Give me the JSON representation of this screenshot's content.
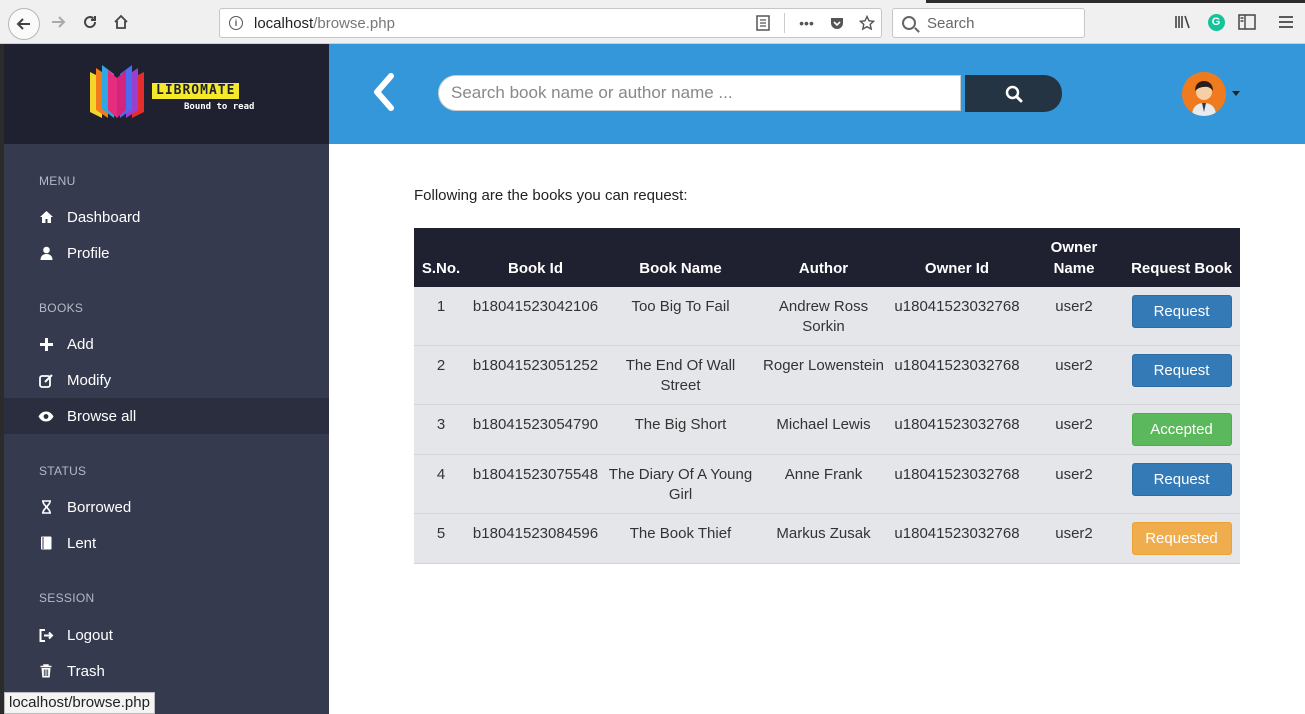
{
  "browser": {
    "url_host": "localhost",
    "url_path": "/browse.php",
    "search_placeholder": "Search",
    "status_url": "localhost/browse.php"
  },
  "logo": {
    "name": "LIBROMATE",
    "tagline": "Bound to read"
  },
  "sidebar": {
    "sections": [
      {
        "title": "MENU",
        "items": [
          {
            "label": "Dashboard",
            "icon": "home-icon"
          },
          {
            "label": "Profile",
            "icon": "user-icon"
          }
        ]
      },
      {
        "title": "BOOKS",
        "items": [
          {
            "label": "Add",
            "icon": "plus-icon"
          },
          {
            "label": "Modify",
            "icon": "edit-icon"
          },
          {
            "label": "Browse all",
            "icon": "eye-icon",
            "active": true
          }
        ]
      },
      {
        "title": "STATUS",
        "items": [
          {
            "label": "Borrowed",
            "icon": "hourglass-icon"
          },
          {
            "label": "Lent",
            "icon": "book-icon"
          }
        ]
      },
      {
        "title": "SESSION",
        "items": [
          {
            "label": "Logout",
            "icon": "logout-icon"
          },
          {
            "label": "Trash",
            "icon": "trash-icon"
          }
        ]
      }
    ]
  },
  "header": {
    "search_placeholder": "Search book name or author name ..."
  },
  "main": {
    "intro": "Following are the books you can request:",
    "columns": [
      "S.No.",
      "Book Id",
      "Book Name",
      "Author",
      "Owner Id",
      "Owner Name",
      "Request Book"
    ],
    "rows": [
      {
        "sno": "1",
        "book_id": "b18041523042106",
        "book_name": "Too Big To Fail",
        "author": "Andrew Ross Sorkin",
        "owner_id": "u18041523032768",
        "owner_name": "user2",
        "action": "Request",
        "status": "primary"
      },
      {
        "sno": "2",
        "book_id": "b18041523051252",
        "book_name": "The End Of Wall Street",
        "author": "Roger Lowenstein",
        "owner_id": "u18041523032768",
        "owner_name": "user2",
        "action": "Request",
        "status": "primary"
      },
      {
        "sno": "3",
        "book_id": "b18041523054790",
        "book_name": "The Big Short",
        "author": "Michael Lewis",
        "owner_id": "u18041523032768",
        "owner_name": "user2",
        "action": "Accepted",
        "status": "success"
      },
      {
        "sno": "4",
        "book_id": "b18041523075548",
        "book_name": "The Diary Of A Young Girl",
        "author": "Anne Frank",
        "owner_id": "u18041523032768",
        "owner_name": "user2",
        "action": "Request",
        "status": "primary"
      },
      {
        "sno": "5",
        "book_id": "b18041523084596",
        "book_name": "The Book Thief",
        "author": "Markus Zusak",
        "owner_id": "u18041523032768",
        "owner_name": "user2",
        "action": "Requested",
        "status": "warning"
      }
    ]
  },
  "colors": {
    "sidebar_bg": "#353a4e",
    "header_bg": "#3497da",
    "table_head_bg": "#1f2030",
    "request": "#337ab7",
    "accepted": "#5cb85c",
    "requested": "#f0ad4e"
  }
}
